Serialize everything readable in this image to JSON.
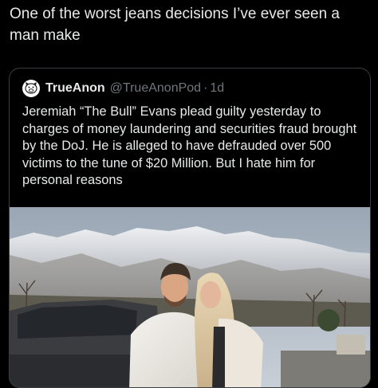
{
  "tweet": {
    "text": "One of the worst jeans decisions I’ve ever seen a man make"
  },
  "quote": {
    "author_name": "TrueAnon",
    "author_handle": "@TrueAnonPod",
    "separator": "·",
    "time": "1d",
    "avatar_icon": "pig-icon",
    "text": "Jeremiah “The Bull” Evans plead guilty yesterday to charges of money laundering and securities fraud brought by the DoJ. He is alleged to have defrauded over 500 victims to the tune of $20 Million. But I hate him for personal reasons"
  },
  "colors": {
    "background": "#000000",
    "text": "#e7e9ea",
    "muted": "#71767b",
    "border": "#3a3d41"
  }
}
